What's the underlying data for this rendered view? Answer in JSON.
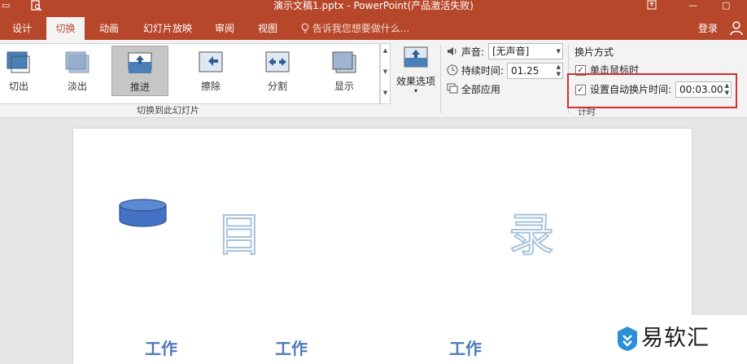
{
  "window": {
    "title": "演示文稿1.pptx - PowerPoint(产品激活失败)"
  },
  "tabs": [
    {
      "label": "设计",
      "active": false
    },
    {
      "label": "切换",
      "active": true
    },
    {
      "label": "动画",
      "active": false
    },
    {
      "label": "幻灯片放映",
      "active": false
    },
    {
      "label": "审阅",
      "active": false
    },
    {
      "label": "视图",
      "active": false
    }
  ],
  "tell_me": "告诉我您想要做什么...",
  "login": "登录",
  "gallery": {
    "items": [
      {
        "label": "切出",
        "icon": "cut-transition-icon",
        "selected": false
      },
      {
        "label": "淡出",
        "icon": "fade-transition-icon",
        "selected": false
      },
      {
        "label": "推进",
        "icon": "push-transition-icon",
        "selected": true
      },
      {
        "label": "擦除",
        "icon": "wipe-transition-icon",
        "selected": false
      },
      {
        "label": "分割",
        "icon": "split-transition-icon",
        "selected": false
      },
      {
        "label": "显示",
        "icon": "reveal-transition-icon",
        "selected": false
      }
    ],
    "group_label": "切换到此幻灯片"
  },
  "effect_options": {
    "label": "效果选项"
  },
  "timing": {
    "sound_label": "声音:",
    "sound_value": "[无声音]",
    "duration_label": "持续时间:",
    "duration_value": "01.25",
    "apply_all_label": "全部应用",
    "advance_title": "换片方式",
    "on_click_label": "单击鼠标时",
    "on_click_checked": true,
    "auto_after_label": "设置自动换片时间:",
    "auto_after_checked": true,
    "auto_after_value": "00:03.00",
    "group_label": "计时"
  },
  "slide": {
    "heading_left": "目",
    "heading_right": "录",
    "items": [
      "工作",
      "工作",
      "工作"
    ]
  },
  "watermark": {
    "text": "易软汇"
  },
  "colors": {
    "accent": "#b7472a",
    "highlight": "#d32f2f",
    "shape_fill": "#4472c4"
  }
}
